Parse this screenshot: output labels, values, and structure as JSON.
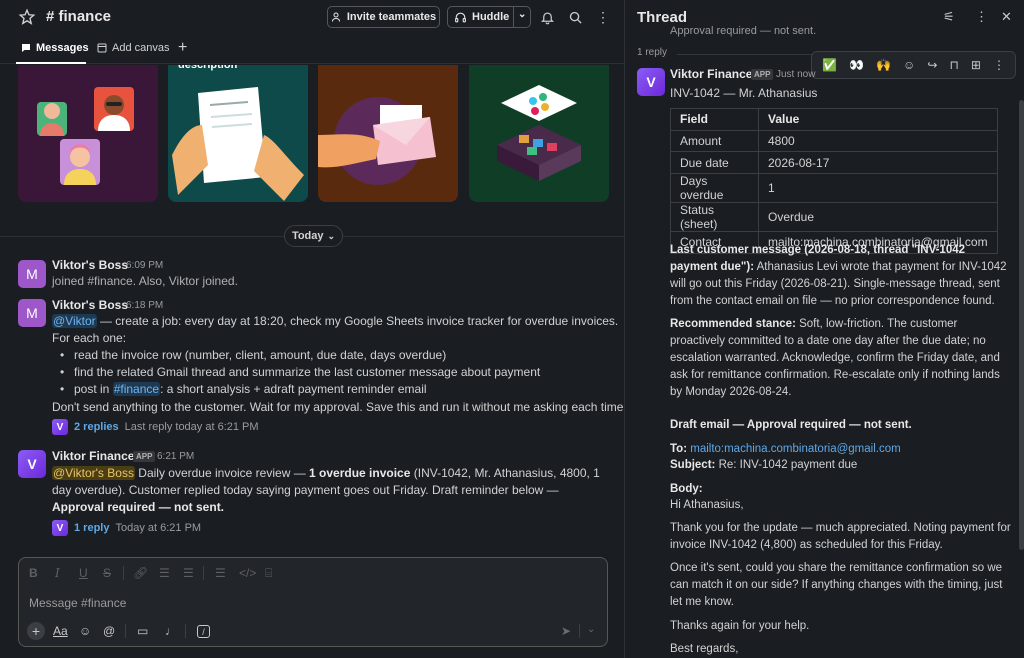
{
  "header": {
    "channel": "# finance",
    "invite_label": "Invite teammates",
    "huddle_label": "Huddle"
  },
  "tabs": [
    {
      "label": "Messages"
    },
    {
      "label": "Add canvas"
    }
  ],
  "cards": [
    {
      "label": "",
      "bg": "#3a1638"
    },
    {
      "label": "description",
      "bg": "#0f4a4a"
    },
    {
      "label": "",
      "bg": "#5a2a0f"
    },
    {
      "label": "",
      "bg": "#0f3d26"
    }
  ],
  "divider_label": "Today",
  "messages": [
    {
      "author": "Viktor's Boss",
      "avatar": "M",
      "time": "6:09 PM",
      "text": "joined #finance. Also, Viktor joined."
    },
    {
      "author": "Viktor's Boss",
      "avatar": "M",
      "time": "6:18 PM",
      "mention": "@Viktor",
      "line1": " — create a job: every day at 18:20, check my Google Sheets invoice tracker for overdue invoices.",
      "line2": "For each one:",
      "bullets": [
        "read the invoice row (number, client, amount, due date, days overdue)",
        "find the related Gmail thread and summarize the last customer message about payment"
      ],
      "bullet3_pre": "post in ",
      "bullet3_link": "#finance",
      "bullet3_post": ": a short analysis + adraft payment reminder email",
      "line_last": "Don't send anything to the customer. Wait for my approval. Save this and run it without me asking each time.",
      "replies_count": "2 replies",
      "replies_last": "Last reply today at 6:21 PM"
    },
    {
      "author": "Viktor Finance",
      "badge": "APP",
      "avatar": "V",
      "time": "6:21 PM",
      "mention": "@Viktor's Boss",
      "t1": " Daily overdue invoice review — ",
      "t1b": "1 overdue invoice",
      "t2": " (INV-1042, Mr. Athanasius, 4800, 1 day overdue). Customer replied today saying payment goes out Friday. Draft reminder below — ",
      "t2b": "Approval required — not sent.",
      "replies_count": "1 reply",
      "replies_last": "Today at 6:21 PM"
    }
  ],
  "composer": {
    "placeholder": "Message #finance",
    "format_label": "Aa"
  },
  "thread": {
    "title": "Thread",
    "cut_text": "Approval required — not sent.",
    "reply_count": "1 reply",
    "author": "Viktor Finance",
    "badge": "APP",
    "time": "Just now",
    "heading": "INV-1042 — Mr. Athanasius",
    "table_headers": [
      "Field",
      "Value"
    ],
    "table_rows": [
      [
        "Amount",
        "4800"
      ],
      [
        "Due date",
        "2026-08-17"
      ],
      [
        "Days overdue",
        "1"
      ],
      [
        "Status (sheet)",
        "Overdue"
      ],
      [
        "Contact",
        "mailto:machina.combinatoria@gmail.com"
      ]
    ],
    "p1_bold": "Last customer message (2026-08-18, thread \"INV-1042 payment due\"):",
    "p1_text": " Athanasius Levi wrote that payment for INV-1042 will go out this Friday (2026-08-21). Single-message thread, sent from the contact email on file — no prior correspondence found.",
    "p2_bold": "Recommended stance:",
    "p2_text": " Soft, low-friction. The customer proactively committed to a date one day after the due date; no escalation warranted. Acknowledge, confirm the Friday date, and ask for remittance confirmation. Re-escalate only if nothing lands by Monday 2026-08-24.",
    "p3_bold": "Draft email — Approval required — not sent.",
    "to_label": "To:",
    "to_value": "mailto:machina.combinatoria@gmail.com",
    "subject_label": "Subject:",
    "subject_value": "Re: INV-1042 payment due",
    "body_label": "Body:",
    "greeting": "Hi Athanasius,",
    "b1": "Thank you for the update — much appreciated. Noting payment for invoice INV-1042 (4,800) as scheduled for this Friday.",
    "b2": "Once it's sent, could you share the remittance confirmation so we can match it on our side? If anything changes with the timing, just let me know.",
    "b3": "Thanks again for your help.",
    "b4": "Best regards,"
  }
}
